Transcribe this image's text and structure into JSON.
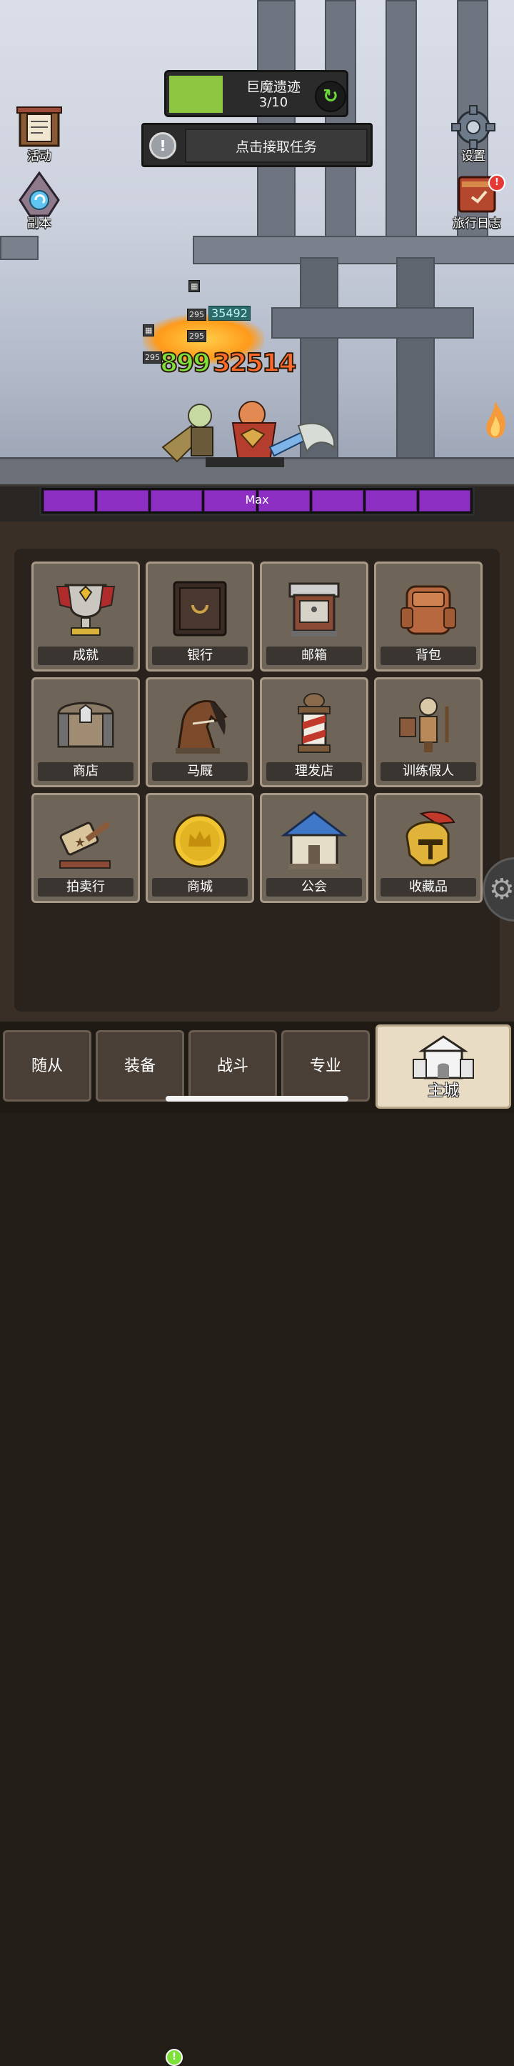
{
  "quest": {
    "name": "巨魔遗迹",
    "progress_text": "3/10",
    "progress_fraction": 0.3,
    "refresh_icon": "refresh-icon",
    "task_prompt": "点击接取任务"
  },
  "side_left": [
    {
      "label": "活动",
      "icon": "events-board-icon"
    },
    {
      "label": "副本",
      "icon": "dungeon-portal-icon"
    }
  ],
  "side_right": [
    {
      "label": "设置",
      "icon": "gear-icon"
    },
    {
      "label": "旅行日志",
      "icon": "journal-book-icon",
      "badge": "!"
    }
  ],
  "battle": {
    "damage_green": "899",
    "damage_orange": "32514",
    "damage_teal": "35492",
    "small_hits": [
      "295",
      "295",
      "295"
    ],
    "rage_label": "Max",
    "rage_segments": 8
  },
  "menu_grid": [
    {
      "label": "成就",
      "icon": "trophy-icon"
    },
    {
      "label": "银行",
      "icon": "safe-icon"
    },
    {
      "label": "邮箱",
      "icon": "mailbox-icon"
    },
    {
      "label": "背包",
      "icon": "backpack-icon"
    },
    {
      "label": "商店",
      "icon": "chest-icon"
    },
    {
      "label": "马厩",
      "icon": "horse-icon"
    },
    {
      "label": "理发店",
      "icon": "barber-pole-icon"
    },
    {
      "label": "训练假人",
      "icon": "training-dummy-icon"
    },
    {
      "label": "拍卖行",
      "icon": "gavel-icon"
    },
    {
      "label": "商城",
      "icon": "gold-coin-icon"
    },
    {
      "label": "公会",
      "icon": "guild-house-icon"
    },
    {
      "label": "收藏品",
      "icon": "helmet-icon"
    }
  ],
  "nav": [
    {
      "label": "随从"
    },
    {
      "label": "装备",
      "badge": "!"
    },
    {
      "label": "战斗"
    },
    {
      "label": "专业"
    },
    {
      "label": "主城",
      "active": true,
      "icon": "castle-icon"
    }
  ],
  "colors": {
    "quest_progress": "#8dc640",
    "rage_bar": "#8e2fc4",
    "damage_green": "#7ee03a",
    "damage_orange": "#ff6a2a",
    "badge_red": "#e53935",
    "badge_green": "#7ee03a"
  }
}
